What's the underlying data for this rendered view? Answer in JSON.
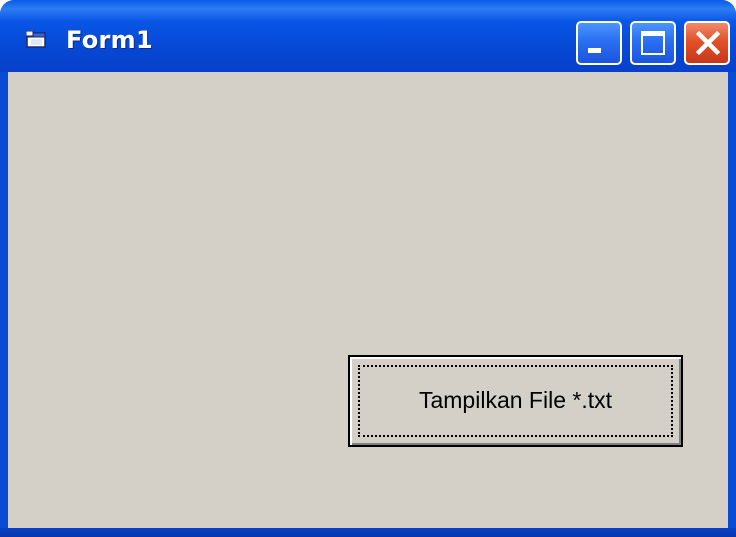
{
  "window": {
    "title": "Form1",
    "icon": "vb-form-icon",
    "controls": {
      "minimize_icon": "minimize-icon",
      "maximize_icon": "maximize-icon",
      "close_icon": "close-icon"
    }
  },
  "form": {
    "button_label": "Tampilkan File *.txt"
  },
  "colors": {
    "titlebar": "#0a4bd6",
    "client_background": "#d4d0c8",
    "close_button": "#e2512a",
    "control_button": "#2a6ff2"
  }
}
